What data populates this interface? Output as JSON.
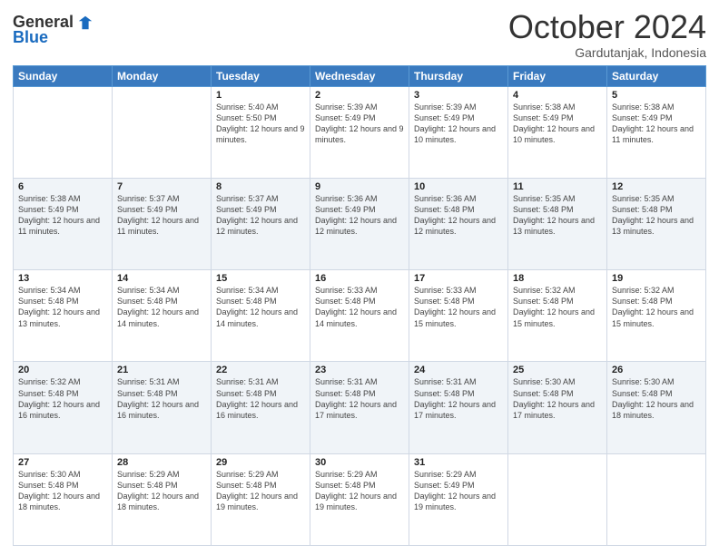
{
  "header": {
    "logo_general": "General",
    "logo_blue": "Blue",
    "month_title": "October 2024",
    "subtitle": "Gardutanjak, Indonesia"
  },
  "weekdays": [
    "Sunday",
    "Monday",
    "Tuesday",
    "Wednesday",
    "Thursday",
    "Friday",
    "Saturday"
  ],
  "weeks": [
    [
      {
        "day": "",
        "info": ""
      },
      {
        "day": "",
        "info": ""
      },
      {
        "day": "1",
        "info": "Sunrise: 5:40 AM\nSunset: 5:50 PM\nDaylight: 12 hours and 9 minutes."
      },
      {
        "day": "2",
        "info": "Sunrise: 5:39 AM\nSunset: 5:49 PM\nDaylight: 12 hours and 9 minutes."
      },
      {
        "day": "3",
        "info": "Sunrise: 5:39 AM\nSunset: 5:49 PM\nDaylight: 12 hours and 10 minutes."
      },
      {
        "day": "4",
        "info": "Sunrise: 5:38 AM\nSunset: 5:49 PM\nDaylight: 12 hours and 10 minutes."
      },
      {
        "day": "5",
        "info": "Sunrise: 5:38 AM\nSunset: 5:49 PM\nDaylight: 12 hours and 11 minutes."
      }
    ],
    [
      {
        "day": "6",
        "info": "Sunrise: 5:38 AM\nSunset: 5:49 PM\nDaylight: 12 hours and 11 minutes."
      },
      {
        "day": "7",
        "info": "Sunrise: 5:37 AM\nSunset: 5:49 PM\nDaylight: 12 hours and 11 minutes."
      },
      {
        "day": "8",
        "info": "Sunrise: 5:37 AM\nSunset: 5:49 PM\nDaylight: 12 hours and 12 minutes."
      },
      {
        "day": "9",
        "info": "Sunrise: 5:36 AM\nSunset: 5:49 PM\nDaylight: 12 hours and 12 minutes."
      },
      {
        "day": "10",
        "info": "Sunrise: 5:36 AM\nSunset: 5:48 PM\nDaylight: 12 hours and 12 minutes."
      },
      {
        "day": "11",
        "info": "Sunrise: 5:35 AM\nSunset: 5:48 PM\nDaylight: 12 hours and 13 minutes."
      },
      {
        "day": "12",
        "info": "Sunrise: 5:35 AM\nSunset: 5:48 PM\nDaylight: 12 hours and 13 minutes."
      }
    ],
    [
      {
        "day": "13",
        "info": "Sunrise: 5:34 AM\nSunset: 5:48 PM\nDaylight: 12 hours and 13 minutes."
      },
      {
        "day": "14",
        "info": "Sunrise: 5:34 AM\nSunset: 5:48 PM\nDaylight: 12 hours and 14 minutes."
      },
      {
        "day": "15",
        "info": "Sunrise: 5:34 AM\nSunset: 5:48 PM\nDaylight: 12 hours and 14 minutes."
      },
      {
        "day": "16",
        "info": "Sunrise: 5:33 AM\nSunset: 5:48 PM\nDaylight: 12 hours and 14 minutes."
      },
      {
        "day": "17",
        "info": "Sunrise: 5:33 AM\nSunset: 5:48 PM\nDaylight: 12 hours and 15 minutes."
      },
      {
        "day": "18",
        "info": "Sunrise: 5:32 AM\nSunset: 5:48 PM\nDaylight: 12 hours and 15 minutes."
      },
      {
        "day": "19",
        "info": "Sunrise: 5:32 AM\nSunset: 5:48 PM\nDaylight: 12 hours and 15 minutes."
      }
    ],
    [
      {
        "day": "20",
        "info": "Sunrise: 5:32 AM\nSunset: 5:48 PM\nDaylight: 12 hours and 16 minutes."
      },
      {
        "day": "21",
        "info": "Sunrise: 5:31 AM\nSunset: 5:48 PM\nDaylight: 12 hours and 16 minutes."
      },
      {
        "day": "22",
        "info": "Sunrise: 5:31 AM\nSunset: 5:48 PM\nDaylight: 12 hours and 16 minutes."
      },
      {
        "day": "23",
        "info": "Sunrise: 5:31 AM\nSunset: 5:48 PM\nDaylight: 12 hours and 17 minutes."
      },
      {
        "day": "24",
        "info": "Sunrise: 5:31 AM\nSunset: 5:48 PM\nDaylight: 12 hours and 17 minutes."
      },
      {
        "day": "25",
        "info": "Sunrise: 5:30 AM\nSunset: 5:48 PM\nDaylight: 12 hours and 17 minutes."
      },
      {
        "day": "26",
        "info": "Sunrise: 5:30 AM\nSunset: 5:48 PM\nDaylight: 12 hours and 18 minutes."
      }
    ],
    [
      {
        "day": "27",
        "info": "Sunrise: 5:30 AM\nSunset: 5:48 PM\nDaylight: 12 hours and 18 minutes."
      },
      {
        "day": "28",
        "info": "Sunrise: 5:29 AM\nSunset: 5:48 PM\nDaylight: 12 hours and 18 minutes."
      },
      {
        "day": "29",
        "info": "Sunrise: 5:29 AM\nSunset: 5:48 PM\nDaylight: 12 hours and 19 minutes."
      },
      {
        "day": "30",
        "info": "Sunrise: 5:29 AM\nSunset: 5:48 PM\nDaylight: 12 hours and 19 minutes."
      },
      {
        "day": "31",
        "info": "Sunrise: 5:29 AM\nSunset: 5:49 PM\nDaylight: 12 hours and 19 minutes."
      },
      {
        "day": "",
        "info": ""
      },
      {
        "day": "",
        "info": ""
      }
    ]
  ]
}
